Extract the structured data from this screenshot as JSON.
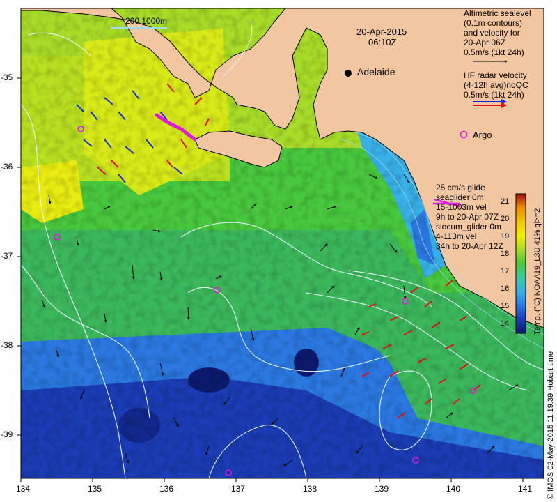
{
  "map": {
    "date": "20-Apr-2015",
    "time": "06:10Z",
    "scale_label": "200  1000m",
    "city": "Adelaide",
    "argo_label": "Argo",
    "x_ticks": [
      "134",
      "135",
      "136",
      "137",
      "138",
      "139",
      "140",
      "141"
    ],
    "y_ticks": [
      "-35",
      "-36",
      "-37",
      "-38",
      "-39"
    ],
    "x_range": [
      134,
      141.3
    ],
    "y_range": [
      -34.5,
      -39.5
    ],
    "projection": "equirectangular lon/lat"
  },
  "legend": {
    "sealevel_lines": [
      "Altimetric sealevel",
      "(0.1m contours)",
      "and velocity for",
      "20-Apr 06Z",
      "0.5m/s (1kt 24h)"
    ],
    "hf_radar_lines": [
      "HF radar velocity",
      "(4-12h avg)noQC",
      "0.5m/s (1kt 24h)"
    ],
    "glider_lines": [
      "25 cm/s glide",
      "seaglider 0m",
      "15-1003m vel",
      "9h to 20-Apr 07Z",
      "slocum_glider 0m",
      "4-113m vel",
      "34h to 20-Apr 12Z"
    ]
  },
  "colorbar": {
    "title": "Temp. (°C) NOAA19_L3U 41% ql>=2",
    "ticks": [
      "21",
      "20",
      "19",
      "18",
      "17",
      "16",
      "15",
      "14"
    ],
    "range": [
      13.5,
      21.5
    ],
    "colors": [
      "#0c1a6e",
      "#1a3cb4",
      "#2a78e0",
      "#38b0e8",
      "#3cc8a0",
      "#48c83c",
      "#a8dc28",
      "#f0f000",
      "#f0c800",
      "#f08c00",
      "#e04000",
      "#a01010"
    ]
  },
  "credits": {
    "source": "© IMOS 02-May-2015 11:19:39 Hobart time"
  },
  "colors": {
    "land": "#f2c6a0",
    "coast": "#000000",
    "contour": "#e8f4ff",
    "hf_radar": "#e01010",
    "hf_radar_blue": "#1a2ad8",
    "glider": "#e018e0",
    "vector": "#000000"
  }
}
